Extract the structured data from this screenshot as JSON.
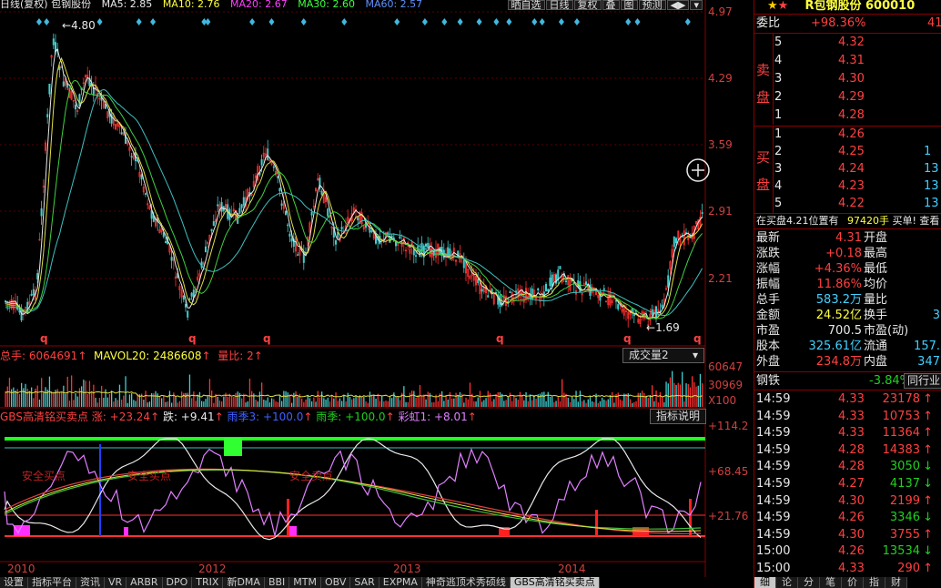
{
  "chart_header": {
    "title": "日线(复权) 包钢股份",
    "ma5": "MA5: 2.85",
    "ma10": "MA10: 2.76",
    "ma20": "MA20: 2.67",
    "ma30": "MA30: 2.60",
    "ma60": "MA60: 2.57"
  },
  "toolbar": [
    "晒自选",
    "日线",
    "复权",
    "叠",
    "图",
    "预测",
    "◀▶",
    "▾"
  ],
  "price_axis": [
    "4.97",
    "4.29",
    "3.59",
    "2.91",
    "2.21"
  ],
  "annotations": {
    "high": "4.80",
    "low": "1.69",
    "q_marks": [
      "q",
      "q",
      "q",
      "q",
      "q",
      "q"
    ]
  },
  "volume": {
    "total": "总手: 6064691",
    "mavol": "MAVOL20: 2486608",
    "ratio": "量比: 2",
    "dropdown": "成交量2",
    "axis": [
      "60647",
      "30969",
      "X100"
    ]
  },
  "indicator": {
    "name": "GBS高清铭买卖点",
    "rise": "涨: +23.24",
    "fall": "跌: +9.41",
    "rain3": "雨季3: +100.0",
    "rain": "雨季: +100.0",
    "rainbow": "彩虹1: +8.01",
    "help_button": "指标说明",
    "axis": [
      "+114.2",
      "+68.45",
      "+21.76"
    ],
    "labels": [
      "安全买点",
      "安全买点",
      "安全卖点"
    ]
  },
  "x_axis": [
    "2010",
    "2012",
    "2013",
    "2014"
  ],
  "bottom_tabs": [
    "设置",
    "指标平台",
    "资讯",
    "VR",
    "ARBR",
    "DPO",
    "TRIX",
    "新DMA",
    "BBI",
    "MTM",
    "OBV",
    "SAR",
    "EXPMA",
    "神奇逃顶术秀硕线",
    "GBS高清铭买卖点"
  ],
  "right_panel": {
    "title": "R包钢股份 600010",
    "weibi_label": "委比",
    "weibi_value": "+98.36%",
    "weicha_value": "41",
    "sell_label": [
      "卖",
      "盘"
    ],
    "buy_label": [
      "买",
      "盘"
    ],
    "sell": [
      {
        "n": "5",
        "price": "4.32",
        "vol": ""
      },
      {
        "n": "4",
        "price": "4.31",
        "vol": ""
      },
      {
        "n": "3",
        "price": "4.30",
        "vol": ""
      },
      {
        "n": "2",
        "price": "4.29",
        "vol": ""
      },
      {
        "n": "1",
        "price": "4.28",
        "vol": ""
      }
    ],
    "buy": [
      {
        "n": "1",
        "price": "4.26",
        "vol": ""
      },
      {
        "n": "2",
        "price": "4.25",
        "vol": "1"
      },
      {
        "n": "3",
        "price": "4.24",
        "vol": "13"
      },
      {
        "n": "4",
        "price": "4.23",
        "vol": "13"
      },
      {
        "n": "5",
        "price": "4.22",
        "vol": "13"
      }
    ],
    "notice": "在买盘4.21位置有",
    "notice_vol": "97420手",
    "notice_act": "买单! 查看",
    "stats": [
      {
        "l": "最新",
        "v": "4.31",
        "l2": "开盘",
        "v2": ""
      },
      {
        "l": "涨跌",
        "v": "+0.18",
        "l2": "最高",
        "v2": ""
      },
      {
        "l": "涨幅",
        "v": "+4.36%",
        "l2": "最低",
        "v2": ""
      },
      {
        "l": "振幅",
        "v": "11.86%",
        "l2": "均价",
        "v2": ""
      },
      {
        "l": "总手",
        "v": "583.2万",
        "l2": "量比",
        "v2": ""
      },
      {
        "l": "金额",
        "v": "24.52亿",
        "l2": "换手",
        "v2": "3"
      },
      {
        "l": "市盈",
        "v": "700.5",
        "l2": "市盈(动)",
        "v2": ""
      },
      {
        "l": "股本",
        "v": "325.61亿",
        "l2": "流通",
        "v2": "157."
      },
      {
        "l": "外盘",
        "v": "234.8万",
        "l2": "内盘",
        "v2": "347"
      }
    ],
    "sector": "钢铁",
    "sector_chg": "-3.84%",
    "sector_btn": "同行业",
    "ticks": [
      {
        "t": "14:59",
        "p": "4.33",
        "v": "23178",
        "d": "up"
      },
      {
        "t": "14:59",
        "p": "4.33",
        "v": "10753",
        "d": "up"
      },
      {
        "t": "14:59",
        "p": "4.33",
        "v": "11364",
        "d": "up"
      },
      {
        "t": "14:59",
        "p": "4.28",
        "v": "14383",
        "d": "up"
      },
      {
        "t": "14:59",
        "p": "4.28",
        "v": "3050",
        "d": "down"
      },
      {
        "t": "14:59",
        "p": "4.27",
        "v": "4137",
        "d": "down"
      },
      {
        "t": "14:59",
        "p": "4.30",
        "v": "2199",
        "d": "up"
      },
      {
        "t": "14:59",
        "p": "4.26",
        "v": "3346",
        "d": "down"
      },
      {
        "t": "14:59",
        "p": "4.30",
        "v": "3755",
        "d": "up"
      },
      {
        "t": "15:00",
        "p": "4.26",
        "v": "13534",
        "d": "down"
      },
      {
        "t": "15:00",
        "p": "4.33",
        "v": "290",
        "d": "up"
      }
    ],
    "tabs": [
      "细",
      "论",
      "分",
      "笔",
      "价",
      "指",
      "财"
    ]
  }
}
